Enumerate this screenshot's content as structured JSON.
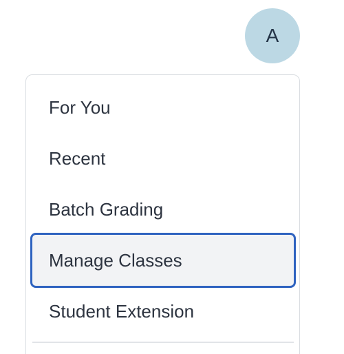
{
  "avatar": {
    "initial": "A",
    "color": "#bcd8e4"
  },
  "menu": {
    "items": [
      {
        "label": "For You"
      },
      {
        "label": "Recent"
      },
      {
        "label": "Batch Grading"
      },
      {
        "label": "Manage Classes",
        "state": "focused"
      },
      {
        "label": "Student Extension"
      }
    ],
    "focus_color": "#2f63c0"
  }
}
